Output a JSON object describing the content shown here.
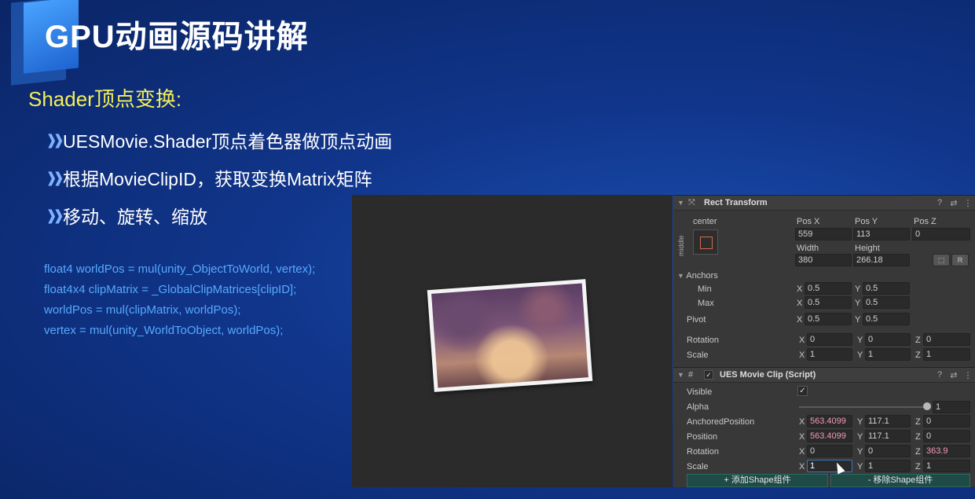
{
  "slide": {
    "title": "GPU动画源码讲解",
    "section": "Shader顶点变换:",
    "bullets": [
      "UESMovie.Shader顶点着色器做顶点动画",
      "根据MovieClipID，获取变换Matrix矩阵",
      "移动、旋转、缩放"
    ],
    "code": [
      "float4 worldPos = mul(unity_ObjectToWorld, vertex);",
      "float4x4 clipMatrix = _GlobalClipMatrices[clipID];",
      "worldPos = mul(clipMatrix, worldPos);",
      "vertex = mul(unity_WorldToObject, worldPos);"
    ]
  },
  "rect_transform": {
    "title": "Rect Transform",
    "anchor_h": "center",
    "anchor_v": "middle",
    "pos_x_label": "Pos X",
    "pos_y_label": "Pos Y",
    "pos_z_label": "Pos Z",
    "pos_x": "559",
    "pos_y": "113",
    "pos_z": "0",
    "width_label": "Width",
    "height_label": "Height",
    "width": "380",
    "height": "266.18",
    "raw_btn": "R",
    "anchors_label": "Anchors",
    "min_label": "Min",
    "max_label": "Max",
    "min_x": "0.5",
    "min_y": "0.5",
    "max_x": "0.5",
    "max_y": "0.5",
    "pivot_label": "Pivot",
    "pivot_x": "0.5",
    "pivot_y": "0.5",
    "rotation_label": "Rotation",
    "rot_x": "0",
    "rot_y": "0",
    "rot_z": "0",
    "scale_label": "Scale",
    "scale_x": "1",
    "scale_y": "1",
    "scale_z": "1"
  },
  "movie_clip": {
    "title": "UES Movie Clip (Script)",
    "visible_label": "Visible",
    "visible_checked": true,
    "alpha_label": "Alpha",
    "alpha": "1",
    "alpha_level": 1.0,
    "anchored_label": "AnchoredPosition",
    "anch_x": "563.4099",
    "anch_y": "117.1",
    "anch_z": "0",
    "position_label": "Position",
    "pos_x": "563.4099",
    "pos_y": "117.1",
    "pos_z": "0",
    "rotation_label": "Rotation",
    "rot_x": "0",
    "rot_y": "0",
    "rot_z": "363.9",
    "scale_label": "Scale",
    "scale_x": "1",
    "scale_y": "1",
    "scale_z": "1",
    "add_button": "+ 添加Shape组件",
    "remove_button": "- 移除Shape组件"
  },
  "axis_labels": {
    "x": "X",
    "y": "Y",
    "z": "Z"
  },
  "icons": {
    "help": "?",
    "settings": "⇄",
    "menu": "⋮",
    "expand": "▼",
    "check": "✓",
    "script": "#",
    "transform": "⤧"
  }
}
